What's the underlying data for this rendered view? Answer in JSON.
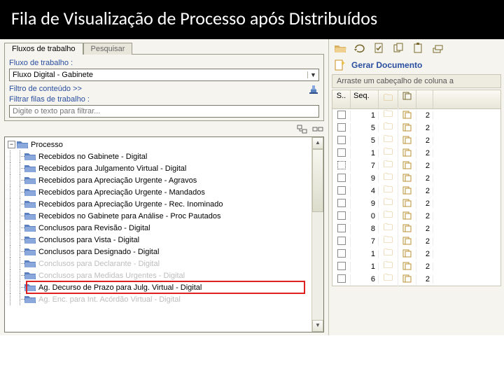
{
  "title": "Fila de Visualização de Processo após Distribuídos",
  "tabs": {
    "active": "Fluxos de trabalho",
    "inactive": "Pesquisar"
  },
  "panel": {
    "fluxo_label": "Fluxo de trabalho :",
    "fluxo_value": "Fluxo Digital - Gabinete",
    "filtro_conteudo": "Filtro de conteúdo >>",
    "filtrar_filas_label": "Filtrar filas de trabalho :",
    "filtrar_placeholder": "Digite o texto para filtrar..."
  },
  "tree": {
    "root": "Processo",
    "items": [
      {
        "label": "Recebidos no Gabinete - Digital",
        "faded": false
      },
      {
        "label": "Recebidos para Julgamento Virtual - Digital",
        "faded": false
      },
      {
        "label": "Recebidos para Apreciação Urgente - Agravos",
        "faded": false
      },
      {
        "label": "Recebidos para Apreciação Urgente - Mandados",
        "faded": false
      },
      {
        "label": "Recebidos para Apreciação Urgente - Rec. Inominado",
        "faded": false
      },
      {
        "label": "Recebidos no Gabinete para Análise - Proc Pautados",
        "faded": false
      },
      {
        "label": "Conclusos para Revisão - Digital",
        "faded": false
      },
      {
        "label": "Conclusos para Vista - Digital",
        "faded": false
      },
      {
        "label": "Conclusos para Designado - Digital",
        "faded": false
      },
      {
        "label": "Conclusos para Declarante - Digital",
        "faded": true
      },
      {
        "label": "Conclusos para Medidas Urgentes - Digital",
        "faded": true
      },
      {
        "label": "Ag. Decurso de Prazo para Julg. Virtual - Digital",
        "faded": false,
        "highlight": true
      },
      {
        "label": "Ag. Enc. para Int. Acórdão Virtual - Digital",
        "faded": true
      }
    ]
  },
  "rightpane": {
    "gerar": "Gerar Documento",
    "group_hint": "Arraste um cabeçalho de coluna a",
    "headers": {
      "s": "S..",
      "seq": "Seq.",
      "n": ""
    },
    "rows": [
      {
        "checked": false,
        "dotted": false,
        "seq": 1,
        "n": 2
      },
      {
        "checked": false,
        "dotted": false,
        "seq": 5,
        "n": 2
      },
      {
        "checked": false,
        "dotted": false,
        "seq": 5,
        "n": 2
      },
      {
        "checked": false,
        "dotted": false,
        "seq": 1,
        "n": 2
      },
      {
        "checked": false,
        "dotted": true,
        "seq": 7,
        "n": 2
      },
      {
        "checked": false,
        "dotted": false,
        "seq": 9,
        "n": 2
      },
      {
        "checked": false,
        "dotted": false,
        "seq": 4,
        "n": 2
      },
      {
        "checked": false,
        "dotted": false,
        "seq": 9,
        "n": 2
      },
      {
        "checked": false,
        "dotted": false,
        "seq": 0,
        "n": 2
      },
      {
        "checked": false,
        "dotted": false,
        "seq": 8,
        "n": 2
      },
      {
        "checked": false,
        "dotted": false,
        "seq": 7,
        "n": 2
      },
      {
        "checked": false,
        "dotted": false,
        "seq": 1,
        "n": 2
      },
      {
        "checked": false,
        "dotted": false,
        "seq": 1,
        "n": 2
      },
      {
        "checked": false,
        "dotted": false,
        "seq": 6,
        "n": 2
      }
    ]
  }
}
